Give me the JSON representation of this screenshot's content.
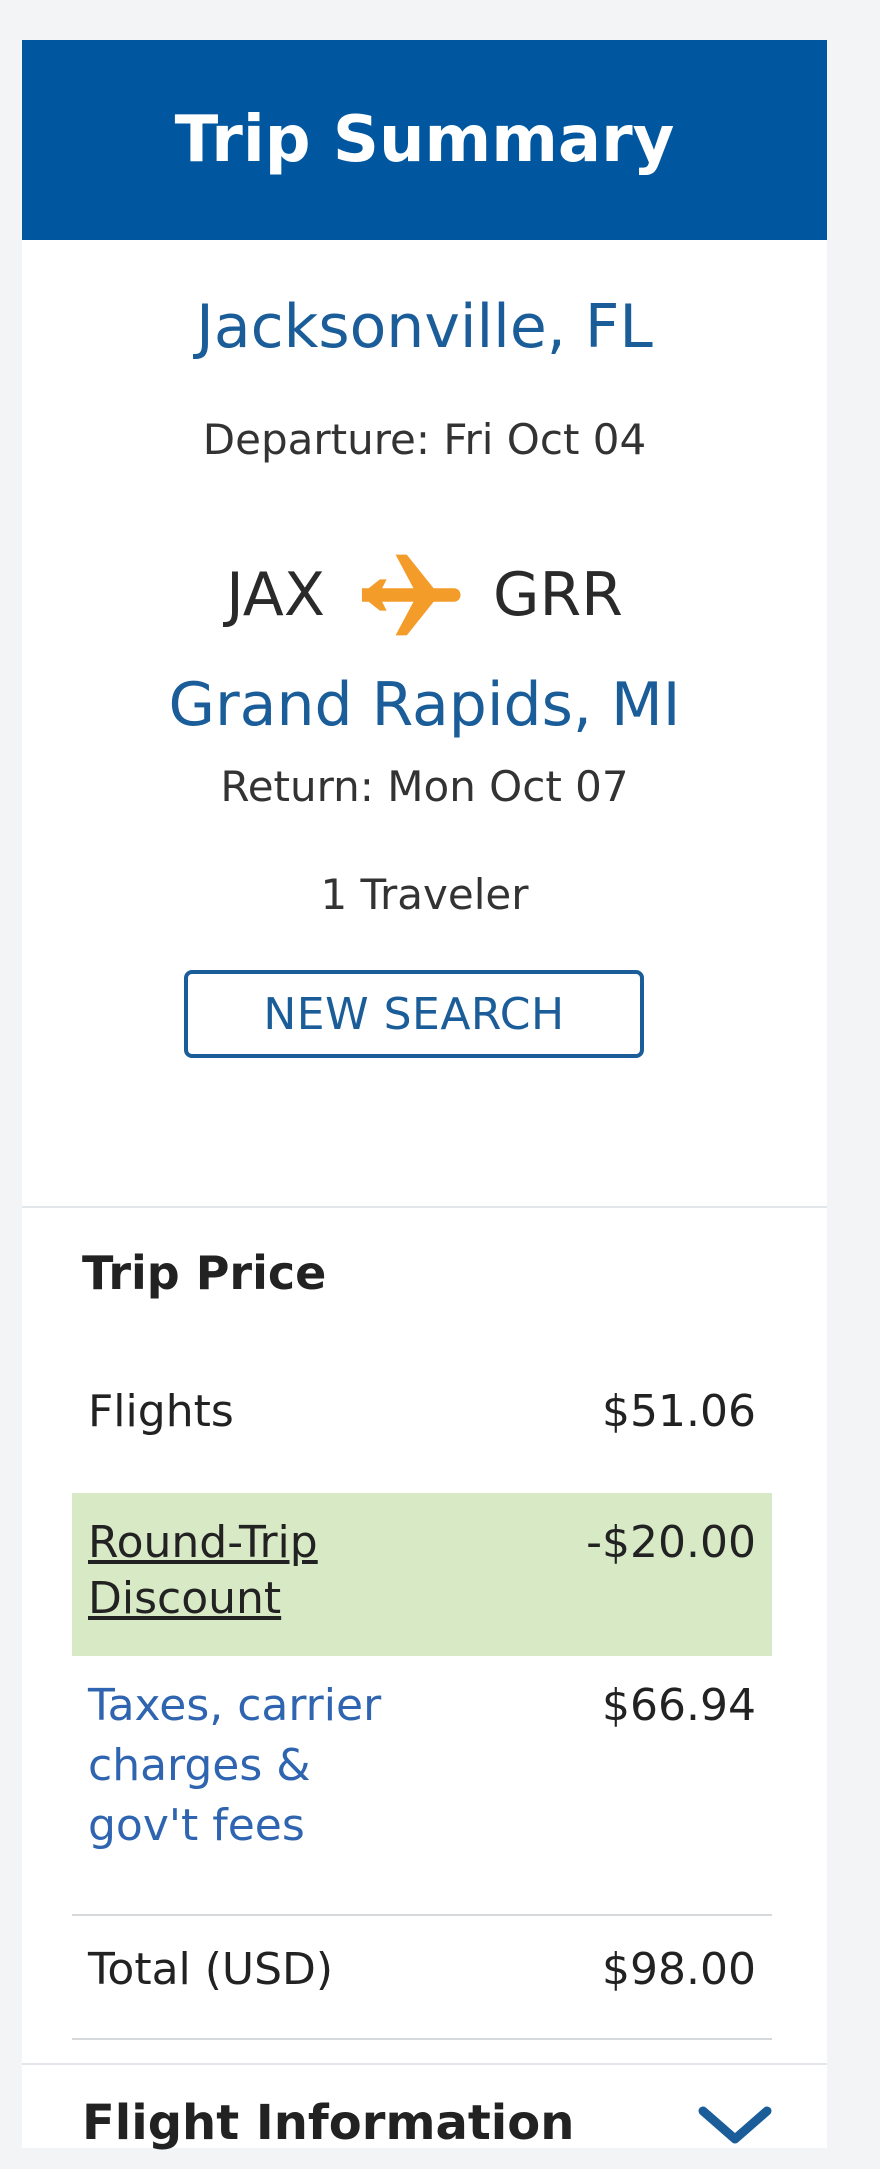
{
  "header": {
    "title": "Trip Summary"
  },
  "trip": {
    "origin_city": "Jacksonville, FL",
    "departure": "Departure: Fri Oct 04",
    "origin_code": "JAX",
    "destination_code": "GRR",
    "destination_city": "Grand Rapids, MI",
    "return": "Return: Mon Oct 07",
    "travelers": "1 Traveler",
    "new_search_label": "NEW SEARCH"
  },
  "price": {
    "title": "Trip Price",
    "flights_label": "Flights",
    "flights_amount": "$51.06",
    "discount_label": "Round-Trip Discount",
    "discount_amount": "-$20.00",
    "taxes_label": "Taxes, carrier charges & gov't fees",
    "taxes_amount": "$66.94",
    "total_label": "Total (USD)",
    "total_amount": "$98.00"
  },
  "flight_info": {
    "label": "Flight Information"
  },
  "icons": {
    "plane": "airplane-icon",
    "chevron": "chevron-down-icon"
  },
  "colors": {
    "header": "#0057a0",
    "city": "#1a5d99",
    "plane": "#f39c2a",
    "discount_bg": "#d8e9c5",
    "link": "#2f65b0"
  }
}
